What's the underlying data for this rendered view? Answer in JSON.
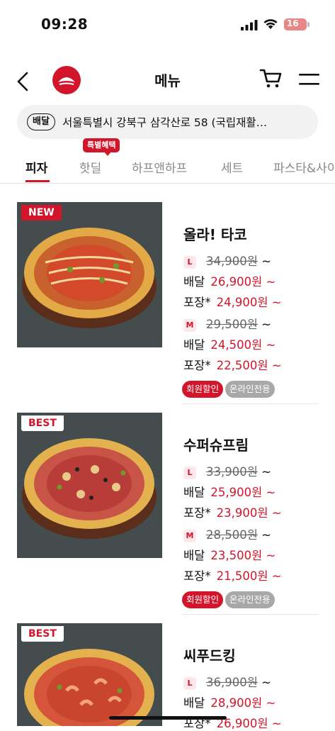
{
  "status_bar": {
    "time": "09:28",
    "battery": "16"
  },
  "header": {
    "title": "메뉴"
  },
  "address": {
    "badge": "배달",
    "text": "서울특별시 강북구 삼각산로 58 (국립재활…"
  },
  "tabs": {
    "items": [
      {
        "label": "피자"
      },
      {
        "label": "핫딜"
      },
      {
        "label": "하프앤하프"
      },
      {
        "label": "세트"
      },
      {
        "label": "파스타&사이드"
      }
    ],
    "promo_badge": "특별혜택"
  },
  "products": [
    {
      "tag": "NEW",
      "name": "올라! 타코",
      "sizes": [
        {
          "size": "L",
          "original": "34,900원",
          "delivery_label": "배달",
          "delivery": "26,900원",
          "pickup_label": "포장*",
          "pickup": "24,900원"
        },
        {
          "size": "M",
          "original": "29,500원",
          "delivery_label": "배달",
          "delivery": "24,500원",
          "pickup_label": "포장*",
          "pickup": "22,500원"
        }
      ],
      "chips": [
        "회원할인",
        "온라인전용"
      ]
    },
    {
      "tag": "BEST",
      "name": "수퍼슈프림",
      "sizes": [
        {
          "size": "L",
          "original": "33,900원",
          "delivery_label": "배달",
          "delivery": "25,900원",
          "pickup_label": "포장*",
          "pickup": "23,900원"
        },
        {
          "size": "M",
          "original": "28,500원",
          "delivery_label": "배달",
          "delivery": "23,500원",
          "pickup_label": "포장*",
          "pickup": "21,500원"
        }
      ],
      "chips": [
        "회원할인",
        "온라인전용"
      ]
    },
    {
      "tag": "BEST",
      "name": "씨푸드킹",
      "sizes": [
        {
          "size": "L",
          "original": "36,900원",
          "delivery_label": "배달",
          "delivery": "28,900원",
          "pickup_label": "포장*",
          "pickup": "26,900원"
        }
      ],
      "chips": []
    }
  ],
  "suffix": "~",
  "colors": {
    "brand_red": "#d3152b",
    "chip_gray": "#a8a8a8"
  }
}
